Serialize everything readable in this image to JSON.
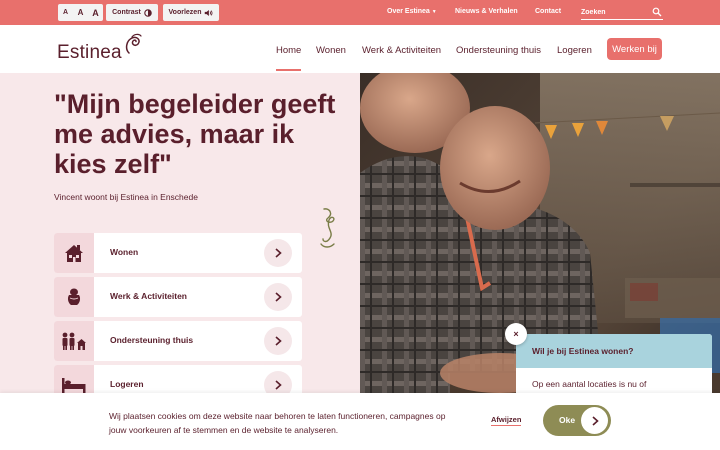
{
  "topbar": {
    "font_sizes": [
      "A",
      "A",
      "A"
    ],
    "contrast_label": "Contrast",
    "voorlezen_label": "Voorlezen",
    "links": {
      "over": "Over Estinea",
      "nieuws": "Nieuws & Verhalen",
      "contact": "Contact"
    },
    "search_placeholder": "Zoeken"
  },
  "header": {
    "logo_text": "Estinea",
    "nav": [
      "Home",
      "Wonen",
      "Werk & Activiteiten",
      "Ondersteuning thuis",
      "Logeren"
    ],
    "active_nav": "Home",
    "cta": "Werken bij"
  },
  "hero": {
    "quote": "\"Mijn begeleider geeft me advies, maar ik kies zelf\"",
    "caption": "Vincent woont bij Estinea in Enschede"
  },
  "cards": [
    {
      "label": "Wonen",
      "icon": "house-icon"
    },
    {
      "label": "Werk & Activiteiten",
      "icon": "hands-icon"
    },
    {
      "label": "Ondersteuning thuis",
      "icon": "family-home-icon"
    },
    {
      "label": "Logeren",
      "icon": "bed-icon"
    }
  ],
  "chat": {
    "close": "×",
    "title": "Wil je bij Estinea wonen?",
    "body": "Op een aantal locaties is nu of"
  },
  "cookie": {
    "text": "Wij plaatsen cookies om deze website naar behoren te laten functioneren, campagnes op jouw voorkeuren af te stemmen en de website te analyseren.",
    "reject": "Afwijzen",
    "accept": "Oke"
  },
  "colors": {
    "brand_coral": "#e8706c",
    "brand_plum": "#5a1f2c",
    "panel_pink": "#f8e8ea",
    "chat_blue": "#a9d3dd",
    "accept_olive": "#8e8c55"
  }
}
